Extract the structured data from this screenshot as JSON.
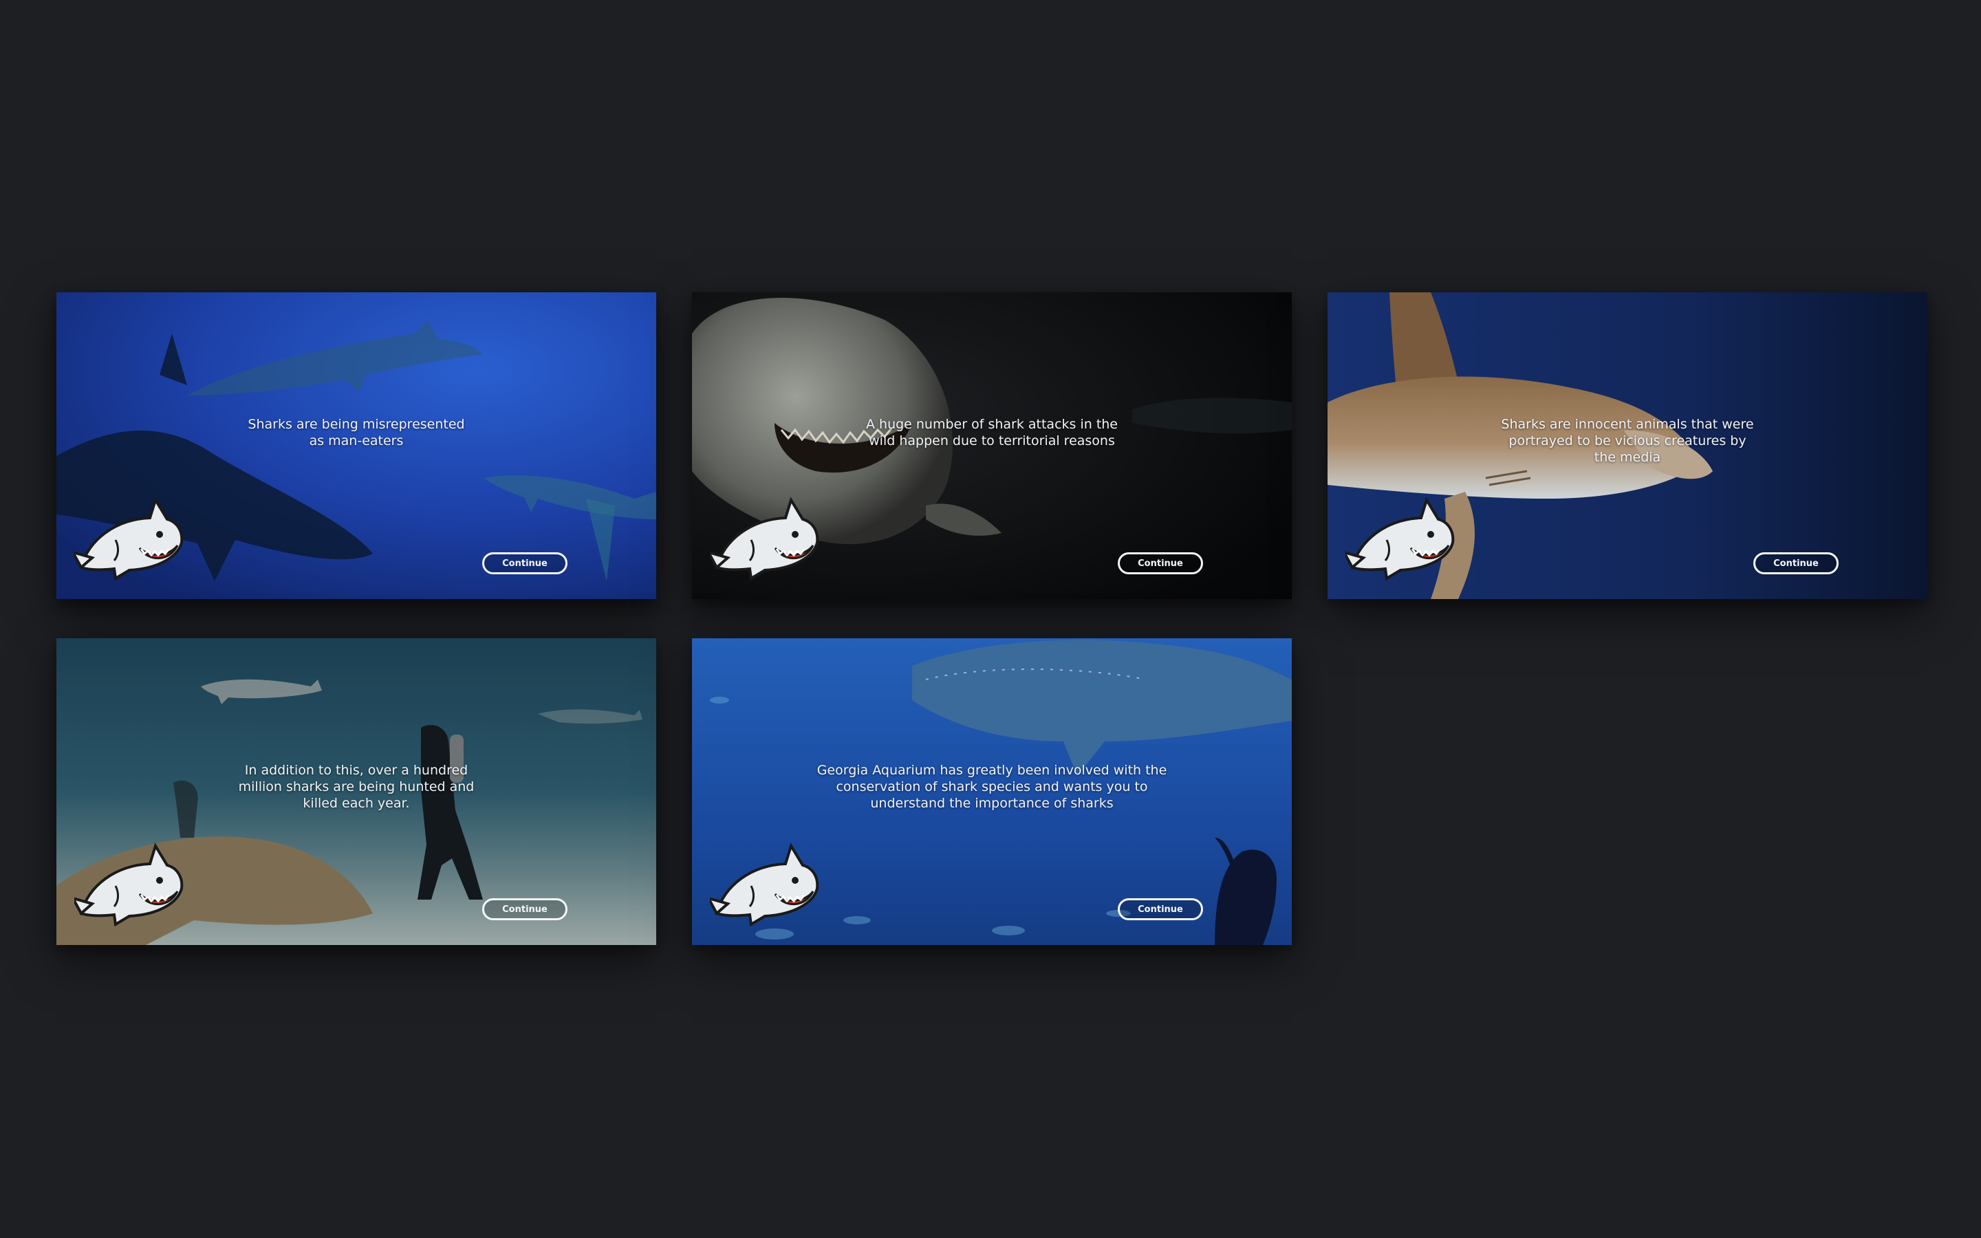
{
  "slides": [
    {
      "caption": [
        "Sharks are being misrepresented",
        "as man-eaters"
      ],
      "button_label": "Continue",
      "mascot_icon": "cartoon-shark-icon"
    },
    {
      "caption": [
        "A huge number of shark attacks in the",
        "wild happen due to territorial reasons"
      ],
      "button_label": "Continue",
      "mascot_icon": "cartoon-shark-icon"
    },
    {
      "caption": [
        "Sharks are innocent animals that were",
        "portrayed to be vicious creatures by",
        "the media"
      ],
      "button_label": "Continue",
      "mascot_icon": "cartoon-shark-icon"
    },
    {
      "caption": [
        "In addition to this, over a hundred",
        "million sharks are being hunted and",
        "killed each year."
      ],
      "button_label": "Continue",
      "mascot_icon": "cartoon-shark-icon"
    },
    {
      "caption": [
        "Georgia Aquarium has greatly been involved with the",
        "conservation of shark species and wants you to",
        "understand the importance of sharks"
      ],
      "button_label": "Continue",
      "mascot_icon": "cartoon-shark-icon"
    }
  ],
  "colors": {
    "board_background": "#1e1f23",
    "ocean_blue": "#1e43a8",
    "deep_black": "#0b0c0e",
    "navy": "#0f1f44",
    "teal_floor": "#2c5060",
    "aquarium_blue": "#1d4fa3",
    "button_border": "#f4f6f8"
  }
}
